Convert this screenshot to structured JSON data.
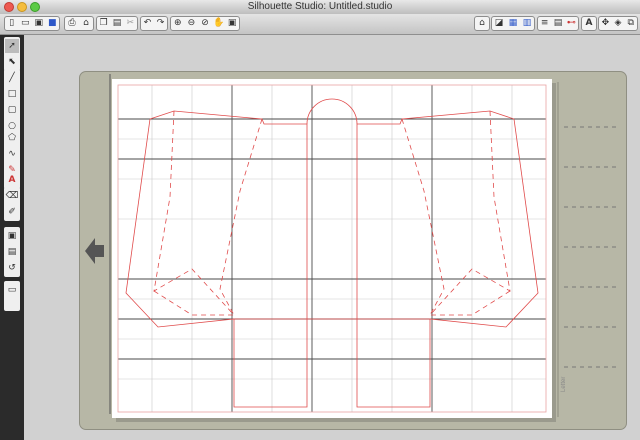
{
  "window": {
    "title": "Silhouette Studio: Untitled.studio",
    "lights": {
      "close": "#ee5a51",
      "minimize": "#f5bd3c",
      "zoom": "#5ccb45"
    }
  },
  "toolbar": {
    "file_icons": [
      "new-document-icon",
      "open-folder-icon",
      "save-icon",
      "save-library-icon"
    ],
    "print_icons": [
      "print-icon",
      "send-to-cutter-icon"
    ],
    "clipboard_icons": [
      "copy-icon",
      "paste-icon",
      "cut-icon"
    ],
    "undo_icons": [
      "undo-icon",
      "redo-icon"
    ],
    "zoom_icons": [
      "zoom-in-icon",
      "zoom-out-icon",
      "zoom-select-icon",
      "pan-hand-icon",
      "fit-to-page-icon"
    ],
    "right_icons": [
      "store-icon",
      "page-setup-icon",
      "grid-icon",
      "registration-icon",
      "line-style-icon",
      "fill-icon",
      "transform-icon",
      "text-style-icon",
      "replicate-icon",
      "align-icon",
      "modify-icon"
    ],
    "text_button": "A"
  },
  "tools": {
    "select": [
      "select-arrow-icon",
      "point-edit-icon"
    ],
    "draw": [
      "line-icon",
      "rectangle-icon",
      "rounded-rectangle-icon",
      "ellipse-icon",
      "polygon-icon",
      "curve-icon",
      "freehand-icon"
    ],
    "text": "A",
    "edit": [
      "eraser-icon",
      "knife-icon"
    ],
    "library": [
      "fill-pattern-icon",
      "library-icon",
      "trace-icon"
    ],
    "extra": [
      "layers-icon"
    ]
  },
  "mat": {
    "paper_color": "#ffffff",
    "mat_color": "#b7b7a6",
    "grid_color": "#555555",
    "cut_line_color": "#e04b4b",
    "side_label": "Letter"
  }
}
